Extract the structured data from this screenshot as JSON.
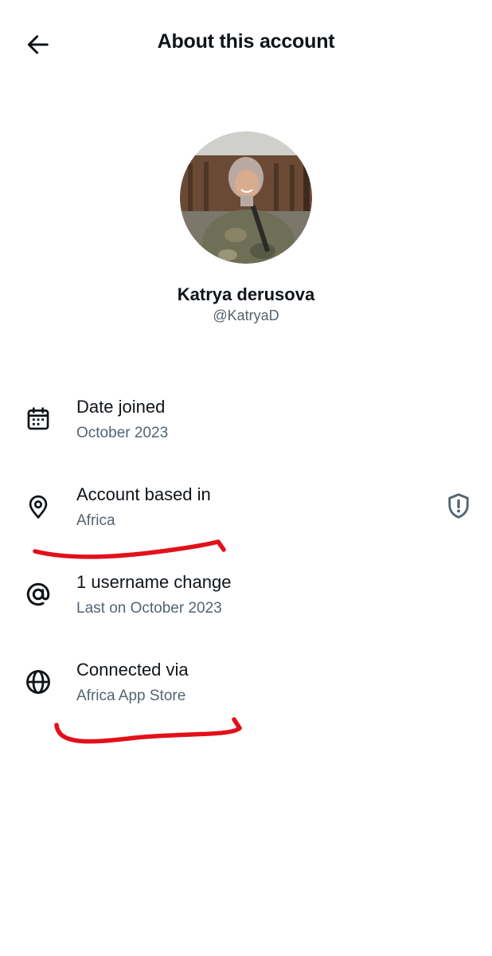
{
  "header": {
    "title": "About this account",
    "back_icon": "arrow-left-icon"
  },
  "profile": {
    "display_name": "Katrya derusova",
    "handle": "@KatryaD"
  },
  "rows": [
    {
      "icon": "calendar-icon",
      "title": "Date joined",
      "subtitle": "October 2023"
    },
    {
      "icon": "location-pin-icon",
      "title": "Account based in",
      "subtitle": "Africa"
    },
    {
      "icon": "at-sign-icon",
      "title": "1 username change",
      "subtitle": "Last on October 2023"
    },
    {
      "icon": "globe-icon",
      "title": "Connected via",
      "subtitle": "Africa App Store"
    }
  ],
  "side_icons": {
    "shield": "shield-alert-icon"
  },
  "colors": {
    "primary_text": "#0f1419",
    "secondary_text": "#536471",
    "annotation_red": "#e3101a"
  }
}
